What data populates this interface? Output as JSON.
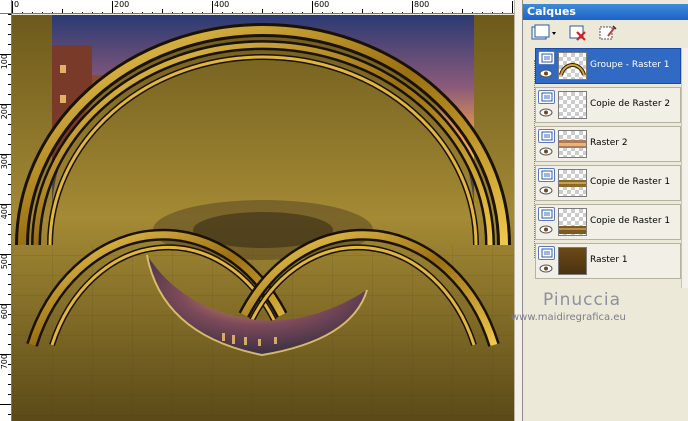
{
  "ruler": {
    "top_labels": [
      "0",
      "200",
      "400",
      "600",
      "800"
    ],
    "left_labels": [
      "100",
      "200",
      "300",
      "400",
      "500",
      "600",
      "700"
    ]
  },
  "palette": {
    "title": "Calques",
    "toolbar": {
      "new_layer_icon": "new-layer-icon",
      "delete_layer_icon": "delete-layer-icon",
      "edit_icon": "layer-properties-icon"
    },
    "layers": [
      {
        "name": "Groupe - Raster 1",
        "selected": true,
        "thumb": "arc"
      },
      {
        "name": "Copie de Raster 2",
        "selected": false,
        "thumb": "checker"
      },
      {
        "name": "Raster 2",
        "selected": false,
        "thumb": "city"
      },
      {
        "name": "Copie de Raster 1",
        "selected": false,
        "thumb": "band"
      },
      {
        "name": "Copie de Raster 1",
        "selected": false,
        "thumb": "band"
      },
      {
        "name": "Raster 1",
        "selected": false,
        "thumb": "brown"
      }
    ]
  },
  "watermark": {
    "name": "Pinuccia",
    "url": "www.maidiregrafica.eu"
  },
  "colors": {
    "selection": "#316ac5",
    "title_bar": "#1e62c6",
    "gold": "#c9a12a",
    "dark_gold": "#5a4510"
  }
}
